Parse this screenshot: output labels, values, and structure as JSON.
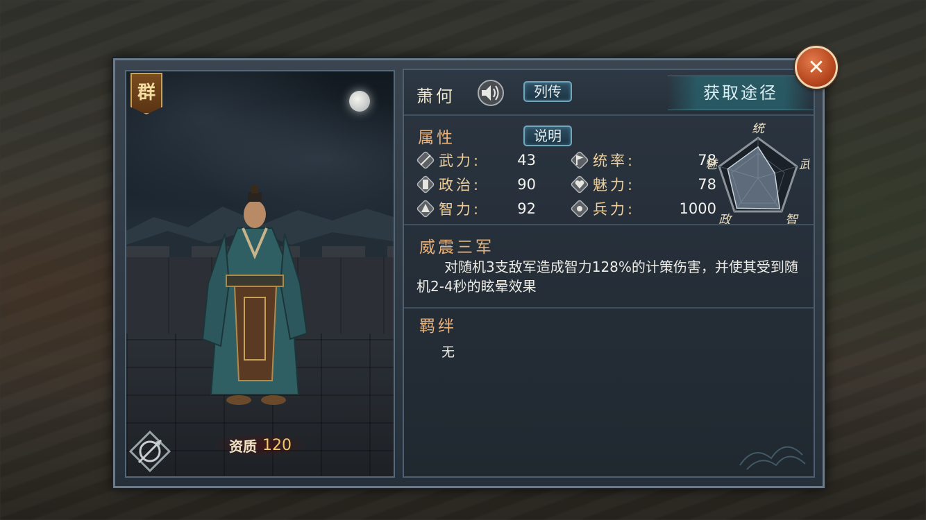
{
  "general": {
    "name": "萧何",
    "faction_badge": "群",
    "aptitude_label": "资质",
    "aptitude_value": "120"
  },
  "header": {
    "biography_button": "列传",
    "acquire_button": "获取途径"
  },
  "attributes": {
    "title": "属性",
    "explain_button": "说明",
    "stats": [
      {
        "label": "武力:",
        "value": "43",
        "icon": "sword-icon"
      },
      {
        "label": "统率:",
        "value": "78",
        "icon": "flag-icon"
      },
      {
        "label": "政治:",
        "value": "90",
        "icon": "scroll-icon"
      },
      {
        "label": "魅力:",
        "value": "78",
        "icon": "heart-icon"
      },
      {
        "label": "智力:",
        "value": "92",
        "icon": "fan-icon"
      },
      {
        "label": "兵力:",
        "value": "1000",
        "icon": "troops-icon"
      }
    ],
    "radar_labels": {
      "top": "统",
      "right": "武",
      "bottom_right": "智",
      "bottom_left": "政",
      "left": "魅"
    },
    "radar_values": {
      "统": 78,
      "武": 43,
      "智": 92,
      "政": 90,
      "魅": 78
    }
  },
  "skill": {
    "name": "威震三军",
    "description": "对随机3支敌军造成智力128%的计策伤害，并使其受到随机2-4秒的眩晕效果"
  },
  "bonds": {
    "title": "羁绊",
    "value": "无"
  },
  "colors": {
    "accent_gold": "#e9b27a",
    "stat_label": "#eecf9b",
    "button_border": "#6fa7bf",
    "close_button": "#b8481f"
  }
}
